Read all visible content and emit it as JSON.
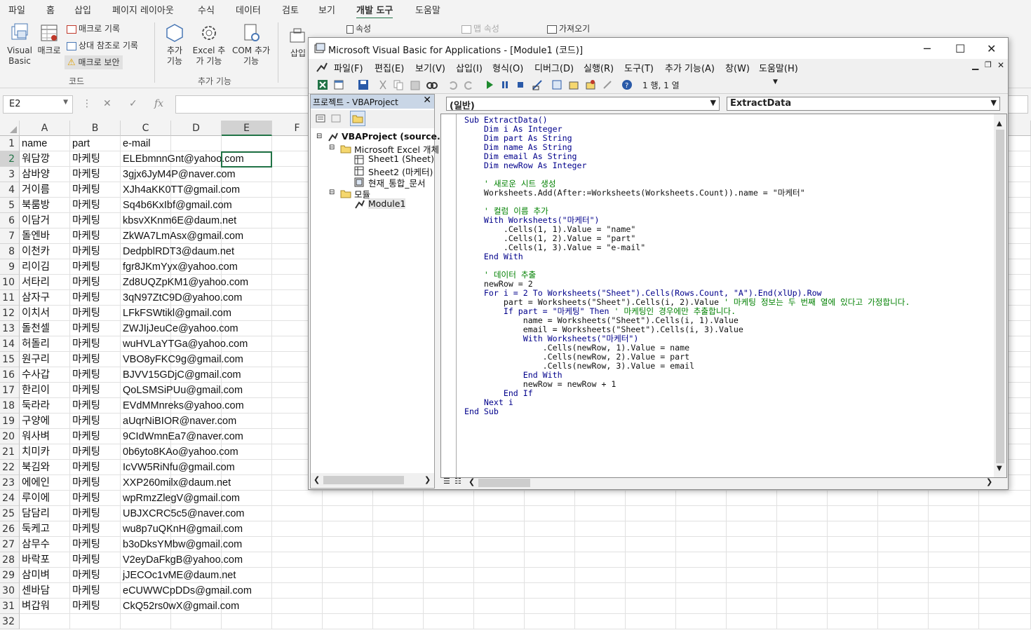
{
  "excel": {
    "menu_tabs": [
      "파일",
      "홈",
      "삽입",
      "페이지 레이아웃",
      "수식",
      "데이터",
      "검토",
      "보기",
      "개발 도구",
      "도움말"
    ],
    "active_tab": "개발 도구",
    "ribbon": {
      "visual_basic": "Visual Basic",
      "macro": "매크로",
      "record_macro": "매크로 기록",
      "relative_ref": "상대 참조로 기록",
      "macro_security": "매크로 보안",
      "group_code": "코드",
      "addins": "추가 기능",
      "excel_addins": "Excel 추가 기능",
      "com_addins": "COM 추가 기능",
      "group_addins": "추가 기능",
      "insert": "삽입",
      "properties": "속성",
      "map_properties": "맵 속성",
      "import": "가져오기"
    },
    "name_box": "E2",
    "formula": "",
    "columns": [
      "A",
      "B",
      "C",
      "D",
      "E",
      "F"
    ],
    "rows": [
      [
        "name",
        "part",
        "e-mail"
      ],
      [
        "워담깡",
        "마케팅",
        "ELEbmnnGnt@yahoo.com"
      ],
      [
        "삼바양",
        "마케팅",
        "3gjx6JyM4P@naver.com"
      ],
      [
        "거이름",
        "마케팅",
        "XJh4aKK0TT@gmail.com"
      ],
      [
        "북룸방",
        "마케팅",
        "Sq4b6KxIbf@gmail.com"
      ],
      [
        "이담거",
        "마케팅",
        "kbsvXKnm6E@daum.net"
      ],
      [
        "돌엔바",
        "마케팅",
        "ZkWA7LmAsx@gmail.com"
      ],
      [
        "이천카",
        "마케팅",
        "DedpblRDT3@daum.net"
      ],
      [
        "리이김",
        "마케팅",
        "fgr8JKmYyx@yahoo.com"
      ],
      [
        "서타리",
        "마케팅",
        "Zd8UQZpKM1@yahoo.com"
      ],
      [
        "삼자구",
        "마케팅",
        "3qN97ZtC9D@yahoo.com"
      ],
      [
        "이치서",
        "마케팅",
        "LFkFSWtikl@gmail.com"
      ],
      [
        "돌천셀",
        "마케팅",
        "ZWJIjJeuCe@yahoo.com"
      ],
      [
        "허돌리",
        "마케팅",
        "wuHVLaYTGa@yahoo.com"
      ],
      [
        "원구리",
        "마케팅",
        "VBO8yFKC9g@gmail.com"
      ],
      [
        "수사갑",
        "마케팅",
        "BJVV15GDjC@gmail.com"
      ],
      [
        "한리이",
        "마케팅",
        "QoLSMSiPUu@gmail.com"
      ],
      [
        "둑라라",
        "마케팅",
        "EVdMMnreks@yahoo.com"
      ],
      [
        "구양에",
        "마케팅",
        "aUqrNiBIOR@naver.com"
      ],
      [
        "워사벼",
        "마케팅",
        "9CIdWmnEa7@naver.com"
      ],
      [
        "치미카",
        "마케팅",
        "0b6yto8KAo@yahoo.com"
      ],
      [
        "북김와",
        "마케팅",
        "IcVW5RiNfu@gmail.com"
      ],
      [
        "에에인",
        "마케팅",
        "XXP260milx@daum.net"
      ],
      [
        "루이에",
        "마케팅",
        "wpRmzZlegV@gmail.com"
      ],
      [
        "담담리",
        "마케팅",
        "UBJXCRC5c5@naver.com"
      ],
      [
        "둑케고",
        "마케팅",
        "wu8p7uQKnH@gmail.com"
      ],
      [
        "삼무수",
        "마케팅",
        "b3oDksYMbw@gmail.com"
      ],
      [
        "바락포",
        "마케팅",
        "V2eyDaFkgB@yahoo.com"
      ],
      [
        "삼미벼",
        "마케팅",
        "jJECOc1vME@daum.net"
      ],
      [
        "센바담",
        "마케팅",
        "eCUWWCpDDs@gmail.com"
      ],
      [
        "벼갑워",
        "마케팅",
        "CkQ52rs0wX@gmail.com"
      ],
      [
        "",
        "",
        ""
      ]
    ]
  },
  "vbe": {
    "title": "Microsoft Visual Basic for Applications - [Module1 (코드)]",
    "menu": [
      "파일(F)",
      "편집(E)",
      "보기(V)",
      "삽입(I)",
      "형식(O)",
      "디버그(D)",
      "실행(R)",
      "도구(T)",
      "추가 기능(A)",
      "창(W)",
      "도움말(H)"
    ],
    "position": "1 행, 1 열",
    "project_title": "프로젝트 - VBAProject",
    "tree": [
      "VBAProject (source.",
      "Microsoft Excel 개체",
      "Sheet1 (Sheet)",
      "Sheet2 (마케터)",
      "현재_통합_문서",
      "모듈",
      "Module1"
    ],
    "object_dropdown": "(일반)",
    "proc_dropdown": "ExtractData",
    "code_lines": [
      "Sub ExtractData()",
      "    Dim i As Integer",
      "    Dim part As String",
      "    Dim name As String",
      "    Dim email As String",
      "    Dim newRow As Integer",
      "",
      "    ' 새로운 시트 생성",
      "    Worksheets.Add(After:=Worksheets(Worksheets.Count)).name = \"마케터\"",
      "",
      "    ' 컬럼 이름 추가",
      "    With Worksheets(\"마케터\")",
      "        .Cells(1, 1).Value = \"name\"",
      "        .Cells(1, 2).Value = \"part\"",
      "        .Cells(1, 3).Value = \"e-mail\"",
      "    End With",
      "",
      "    ' 데이터 추출",
      "    newRow = 2",
      "    For i = 2 To Worksheets(\"Sheet\").Cells(Rows.Count, \"A\").End(xlUp).Row",
      "        part = Worksheets(\"Sheet\").Cells(i, 2).Value ' 마케팅 정보는 두 번째 열에 있다고 가정합니다.",
      "        If part = \"마케팅\" Then ' 마케팅인 경우에만 추출합니다.",
      "            name = Worksheets(\"Sheet\").Cells(i, 1).Value",
      "            email = Worksheets(\"Sheet\").Cells(i, 3).Value",
      "            With Worksheets(\"마케터\")",
      "                .Cells(newRow, 1).Value = name",
      "                .Cells(newRow, 2).Value = part",
      "                .Cells(newRow, 3).Value = email",
      "            End With",
      "            newRow = newRow + 1",
      "        End If",
      "    Next i",
      "End Sub"
    ]
  },
  "colors": {
    "excel_green": "#217346",
    "comment_green": "#008000",
    "keyword_blue": "#00008b"
  }
}
